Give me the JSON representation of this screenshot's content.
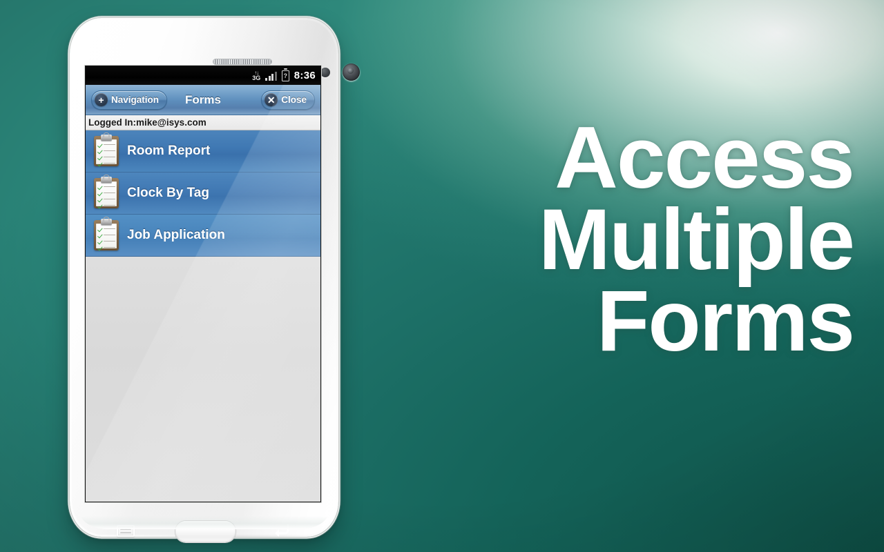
{
  "background": {
    "accent_teal": "#1b6d67",
    "accent_green_dark": "#0e5147",
    "highlight": "#ffffff"
  },
  "promo": {
    "line1": "Access",
    "line2": "Multiple",
    "line3": "Forms"
  },
  "phone": {
    "hardware": {
      "menu_key_label": "Menu",
      "home_key_label": "Home",
      "back_key_label": "Back",
      "earpiece_label": "Earpiece Speaker",
      "camera_label": "Front Camera"
    },
    "statusbar": {
      "network_arrows": "↑↓",
      "network_type": "3G",
      "signal_label": "Signal",
      "battery_label": "?",
      "time": "8:36"
    },
    "toolbar": {
      "nav_icon": "+",
      "nav_label": "Navigation",
      "title": "Forms",
      "close_icon": "✕",
      "close_label": "Close"
    },
    "session": {
      "logged_in_text": "Logged In:mike@isys.com"
    },
    "forms": [
      {
        "label": "Room Report",
        "icon": "clipboard-icon"
      },
      {
        "label": "Clock By Tag",
        "icon": "clipboard-icon"
      },
      {
        "label": "Job Application",
        "icon": "clipboard-icon"
      }
    ]
  }
}
